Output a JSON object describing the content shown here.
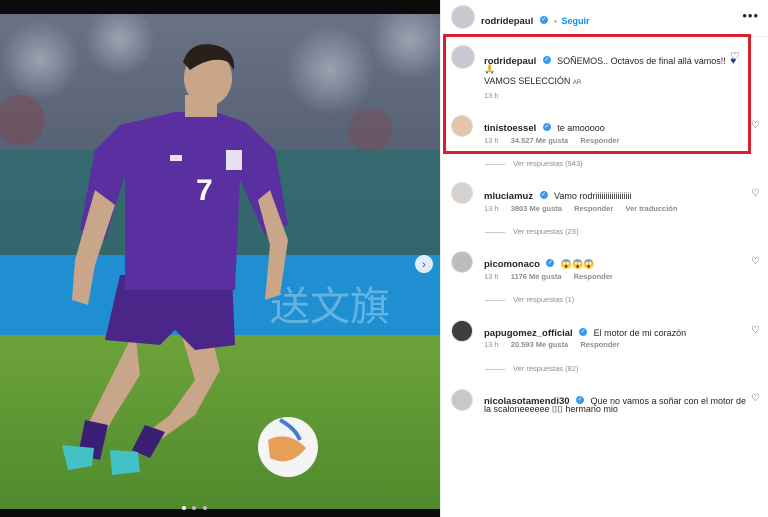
{
  "header": {
    "username": "rodridepaul",
    "follow_label": "Seguir",
    "more_icon": "ellipsis-icon"
  },
  "caption": {
    "username": "rodridepaul",
    "text": "SOÑEMOS.. Octavos de final allá vamos!!",
    "line2": "VAMOS SELECCIÓN",
    "line2_flag": "AR",
    "time": "13 h",
    "heart_color": "#1b3a8c"
  },
  "comments": [
    {
      "username": "tinistoessel",
      "text": "te amooooo",
      "time": "13 h",
      "likes": "34.527 Me gusta",
      "reply": "Responder",
      "translate": "",
      "view_replies": "Ver respuestas (943)"
    },
    {
      "username": "mluciamuz",
      "text": "Vamo rodriiiiiiiiiiiiiiiiii",
      "time": "13 h",
      "likes": "3803 Me gusta",
      "reply": "Responder",
      "translate": "Ver traducción",
      "view_replies": "Ver respuestas (23)"
    },
    {
      "username": "picomonaco",
      "text": "😱😱😱",
      "time": "13 h",
      "likes": "1176 Me gusta",
      "reply": "Responder",
      "translate": "",
      "view_replies": "Ver respuestas (1)"
    },
    {
      "username": "papugomez_official",
      "text": "El motor de mi corazón",
      "time": "13 h",
      "likes": "20.593 Me gusta",
      "reply": "Responder",
      "translate": "",
      "view_replies": "Ver respuestas (82)"
    },
    {
      "username": "nicolasotamendi30",
      "text": "Que no vamos a soñar con el motor de",
      "text2": "la scaloneeeeee ⌷⌷ hermano mio",
      "time": "",
      "likes": "",
      "reply": "",
      "translate": "",
      "view_replies": ""
    }
  ],
  "photo": {
    "jersey_number": "7",
    "carousel_next_icon": "chevron-right-icon",
    "dots": 3
  },
  "colors": {
    "jersey": "#5a2fa0",
    "verified": "#3897f0",
    "follow": "#0095f6",
    "highlight": "#d9202a",
    "pitch": "#4e8a2c"
  }
}
